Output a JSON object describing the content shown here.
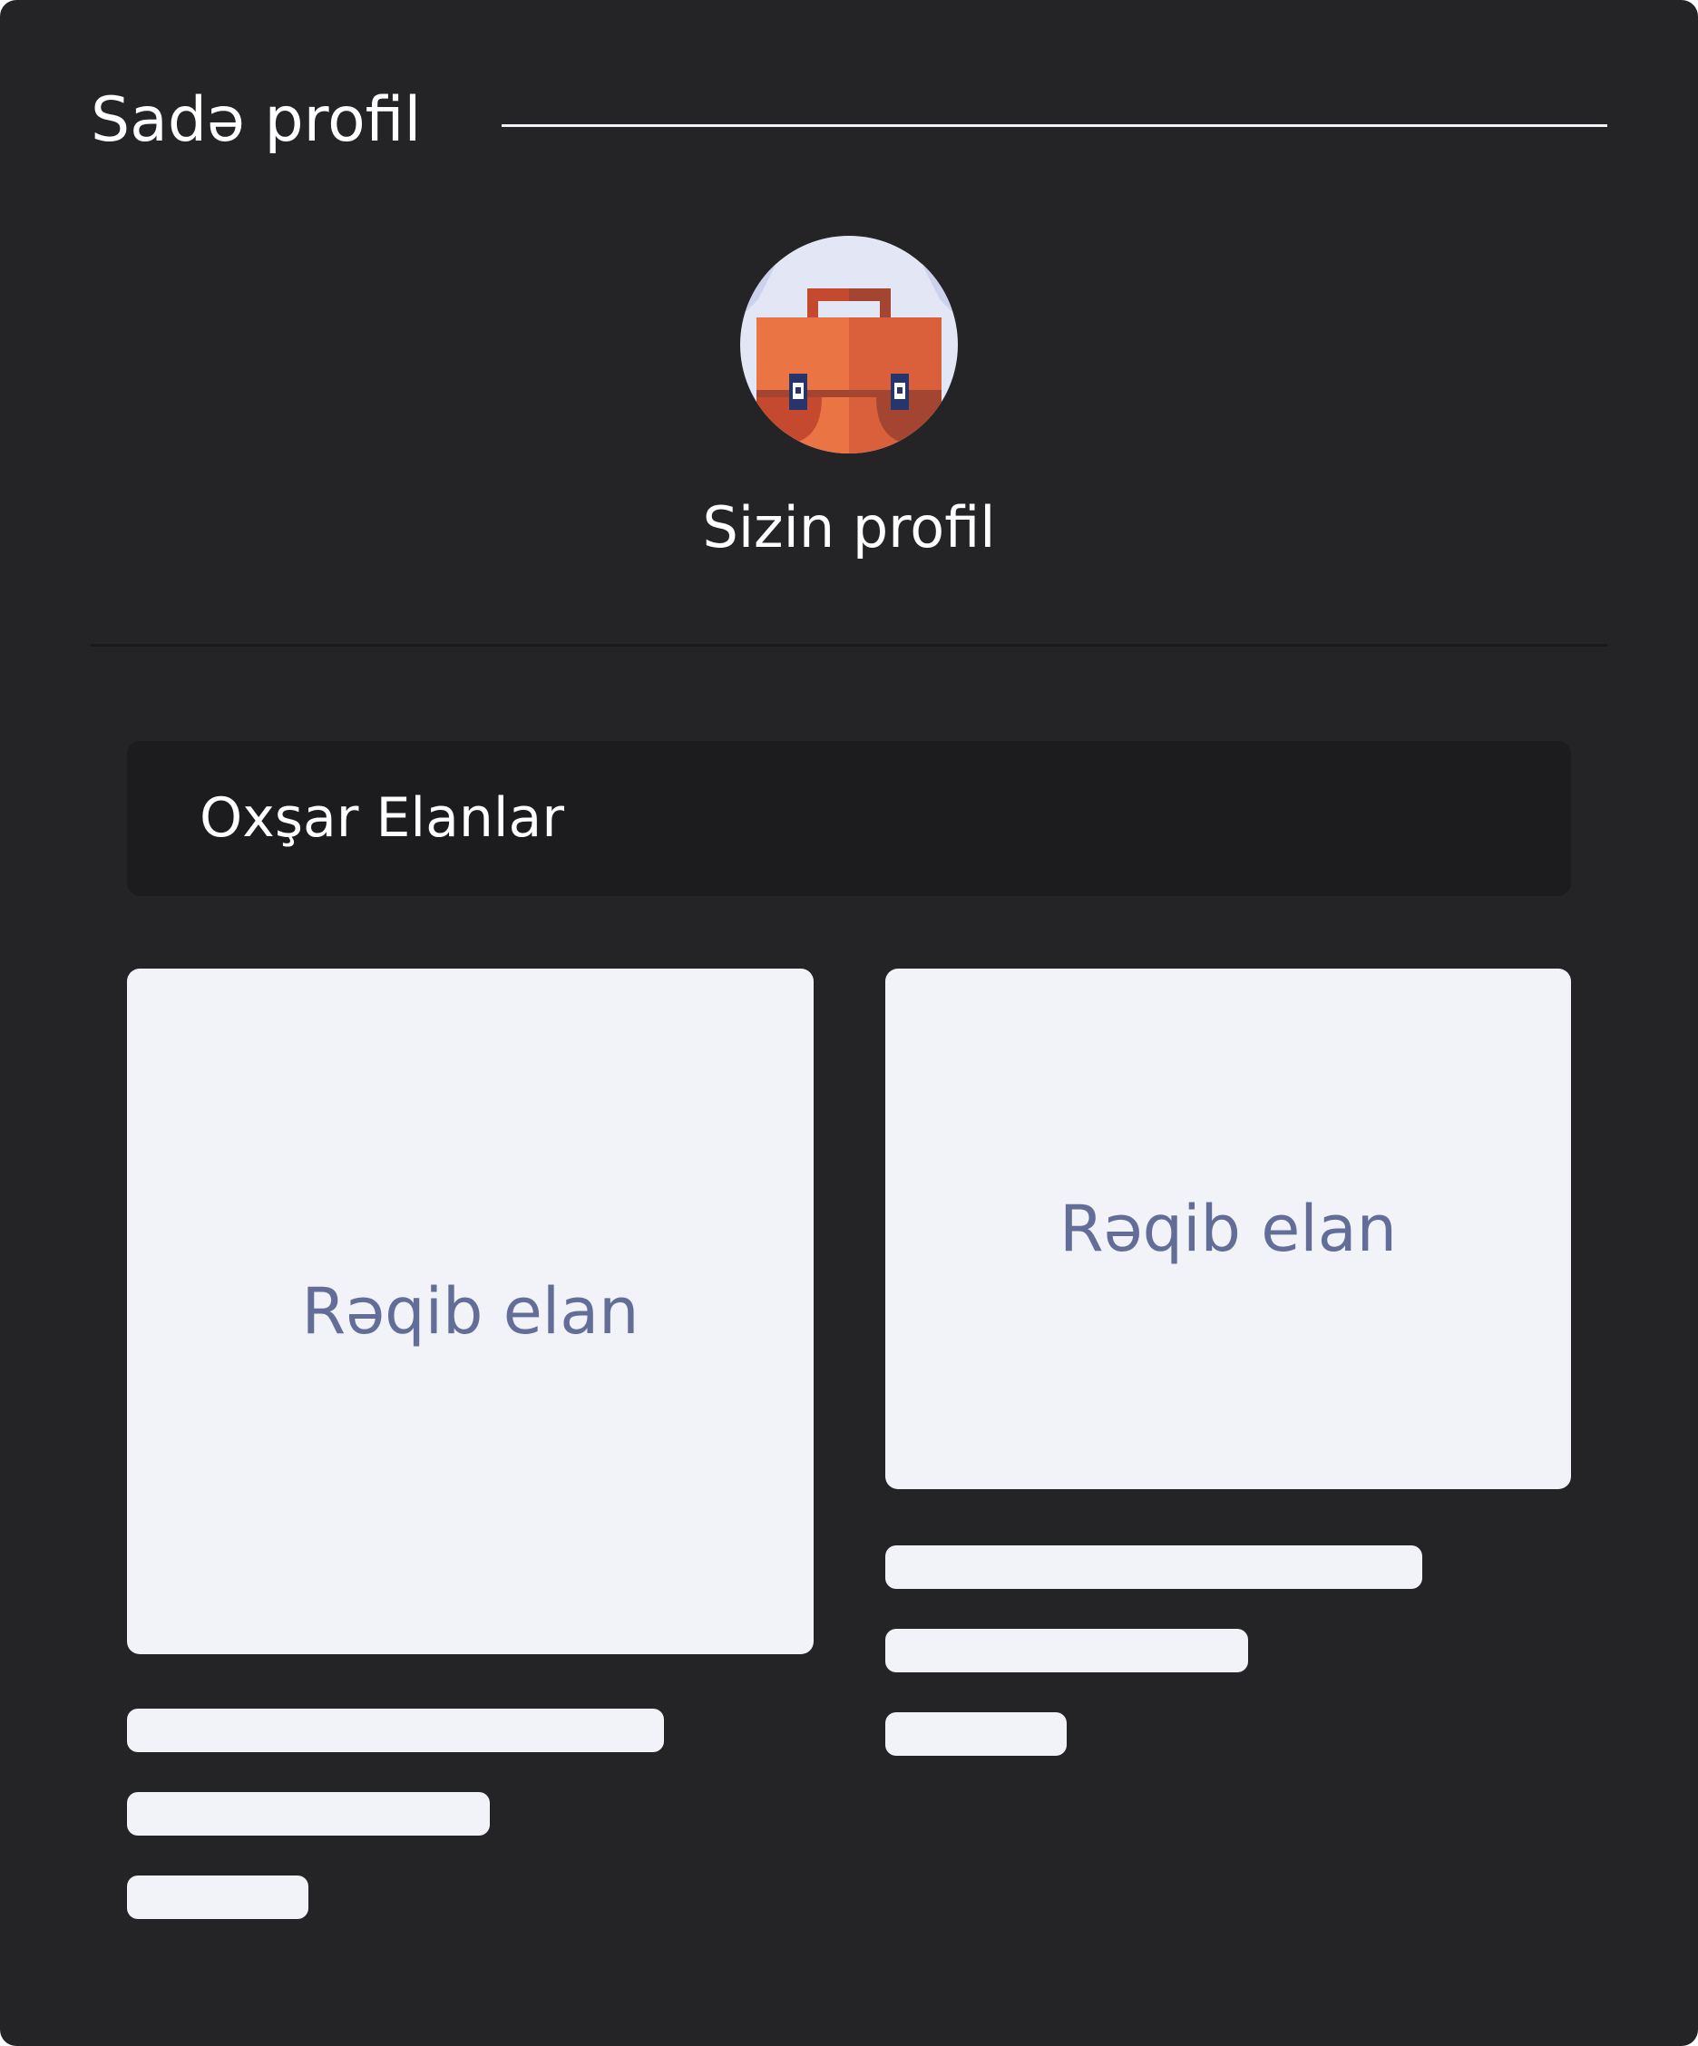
{
  "header": {
    "title": "Sadə profil"
  },
  "profile": {
    "name": "Sizin profil",
    "avatar_icon": "briefcase-icon"
  },
  "similar_listings": {
    "title": "Oxşar Elanlar",
    "cards": [
      {
        "image_label": "Rəqib elan"
      },
      {
        "image_label": "Rəqib elan"
      }
    ]
  },
  "colors": {
    "panel_background": "#242426",
    "section_bar": "#1c1c1e",
    "card_placeholder": "#f2f3f8",
    "placeholder_text": "#636e98",
    "briefcase_orange": "#ea7444",
    "briefcase_dark": "#a34531"
  }
}
